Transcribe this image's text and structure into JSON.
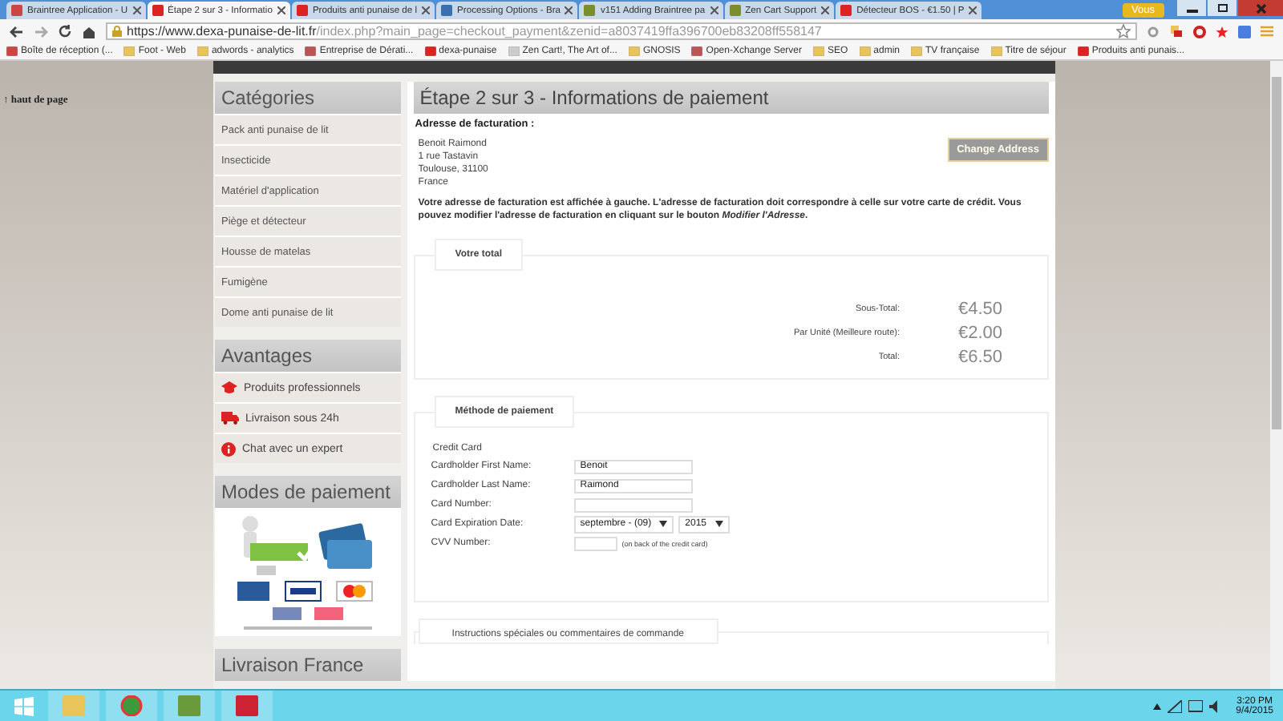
{
  "browser": {
    "tabs": [
      {
        "title": "Braintree Application - U",
        "kind": "mail",
        "selected": false
      },
      {
        "title": "Étape 2 sur 3 - Informatio",
        "kind": "dexa",
        "selected": true
      },
      {
        "title": "Produits anti punaise de l",
        "kind": "dexa",
        "selected": false
      },
      {
        "title": "Processing Options - Bra",
        "kind": "braintree",
        "selected": false
      },
      {
        "title": "v151 Adding Braintree pa",
        "kind": "zencart",
        "selected": false
      },
      {
        "title": "Zen Cart Support",
        "kind": "zencart",
        "selected": false
      },
      {
        "title": "Détecteur BOS - €1.50 | P",
        "kind": "dexa",
        "selected": false
      }
    ],
    "user_badge": "Vous",
    "url": {
      "host": "https://www.dexa-punaise-de-lit.fr",
      "path": "/index.php?main_page=checkout_payment&zenid=a8037419ffa396700eb83208ff558147"
    },
    "bookmarks": [
      {
        "label": "Boîte de réception (...",
        "kind": "mail"
      },
      {
        "label": "Foot - Web",
        "kind": "folder"
      },
      {
        "label": "adwords - analytics",
        "kind": "folder"
      },
      {
        "label": "Entreprise de Dérati...",
        "kind": "site"
      },
      {
        "label": "dexa-punaise",
        "kind": "dexa"
      },
      {
        "label": "Zen Cart!, The Art of...",
        "kind": "page"
      },
      {
        "label": "GNOSIS",
        "kind": "folder"
      },
      {
        "label": "Open-Xchange Server",
        "kind": "site"
      },
      {
        "label": "SEO",
        "kind": "folder"
      },
      {
        "label": "admin",
        "kind": "folder"
      },
      {
        "label": "TV française",
        "kind": "folder"
      },
      {
        "label": "Titre de séjour",
        "kind": "folder"
      },
      {
        "label": "Produits anti punais...",
        "kind": "dexa"
      }
    ]
  },
  "page": {
    "back_to_top": "↑ haut de page",
    "sidebar": [
      {
        "title": "Catégories",
        "kind": "links",
        "items": [
          {
            "label": "Pack anti punaise de lit"
          },
          {
            "label": "Insecticide"
          },
          {
            "label": "Matériel d'application"
          },
          {
            "label": "Piège et détecteur"
          },
          {
            "label": "Housse de matelas"
          },
          {
            "label": "Fumigène"
          },
          {
            "label": "Dome anti punaise de lit"
          }
        ]
      },
      {
        "title": "Avantages",
        "kind": "advantages",
        "items": [
          {
            "label": "Produits professionnels"
          },
          {
            "label": "Livraison sous 24h"
          },
          {
            "label": "Chat avec un expert"
          }
        ]
      },
      {
        "title": "Modes de paiement",
        "kind": "payment_image"
      },
      {
        "title": "Livraison France",
        "kind": "links"
      }
    ],
    "main": {
      "title": "Étape 2 sur 3 - Informations de paiement",
      "billing": {
        "heading": "Adresse de facturation :",
        "lines": [
          "Benoit Raimond",
          "1 rue Tastavin",
          "Toulouse, 31100",
          "France"
        ],
        "button": "Change Address",
        "note": "Votre adresse de facturation est affichée à gauche. L'adresse de facturation doit correspondre à celle sur votre carte de crédit. Vous pouvez modifier l'adresse de facturation en cliquant sur le bouton *Modifier l'Adresse*."
      },
      "totals": {
        "legend": "Votre total",
        "rows": [
          {
            "label": "Sous-Total:",
            "value": "€4.50"
          },
          {
            "label": "Par Unité (Meilleure route):",
            "value": "€2.00"
          },
          {
            "label": "Total:",
            "value": "€6.50"
          }
        ]
      },
      "payment": {
        "legend": "Méthode de paiement",
        "method": "Credit Card",
        "fields": [
          {
            "label": "Cardholder First Name:",
            "kind": "text",
            "value": "Benoit"
          },
          {
            "label": "Cardholder Last Name:",
            "kind": "text",
            "value": "Raimond"
          },
          {
            "label": "Card Number:",
            "kind": "text"
          },
          {
            "label": "Card Expiration Date:",
            "kind": "date",
            "month": "septembre - (09)",
            "year": "2015"
          },
          {
            "label": "CVV Number:",
            "kind": "cvv",
            "hint": "(on back of the credit card)"
          }
        ]
      },
      "comments": {
        "legend": "Instructions spéciales ou commentaires de commande"
      }
    }
  },
  "taskbar": {
    "apps": [
      {
        "kind": "explorer"
      },
      {
        "kind": "chrome"
      },
      {
        "kind": "notepad"
      },
      {
        "kind": "filezilla"
      }
    ],
    "time": "3:20 PM",
    "date": "9/4/2015"
  }
}
